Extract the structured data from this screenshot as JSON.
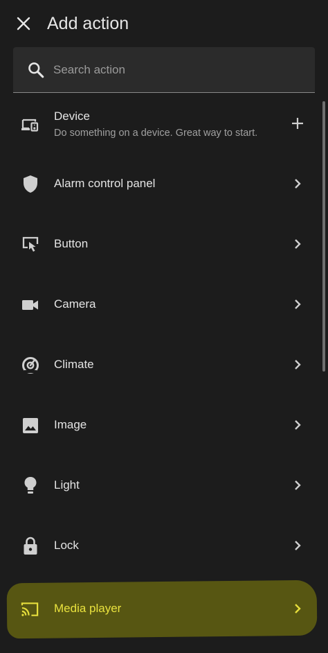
{
  "header": {
    "title": "Add action",
    "close_icon": "close-icon"
  },
  "search": {
    "placeholder": "Search action",
    "value": "",
    "icon": "search-icon"
  },
  "items": [
    {
      "label": "Device",
      "description": "Do something on a device. Great way to start.",
      "icon": "devices-icon",
      "action_icon": "plus-icon"
    },
    {
      "label": "Alarm control panel",
      "icon": "shield-icon",
      "action_icon": "chevron-right-icon"
    },
    {
      "label": "Button",
      "icon": "gesture-tap-button-icon",
      "action_icon": "chevron-right-icon"
    },
    {
      "label": "Camera",
      "icon": "video-camera-icon",
      "action_icon": "chevron-right-icon"
    },
    {
      "label": "Climate",
      "icon": "thermostat-icon",
      "action_icon": "chevron-right-icon"
    },
    {
      "label": "Image",
      "icon": "image-icon",
      "action_icon": "chevron-right-icon"
    },
    {
      "label": "Light",
      "icon": "lightbulb-icon",
      "action_icon": "chevron-right-icon"
    },
    {
      "label": "Lock",
      "icon": "lock-icon",
      "action_icon": "chevron-right-icon"
    },
    {
      "label": "Media player",
      "icon": "cast-icon",
      "action_icon": "chevron-right-icon",
      "highlighted": true
    }
  ],
  "colors": {
    "background": "#1c1c1c",
    "search_background": "#2b2b2b",
    "highlight": "#5b5a12",
    "highlight_text": "#e9e23e"
  }
}
